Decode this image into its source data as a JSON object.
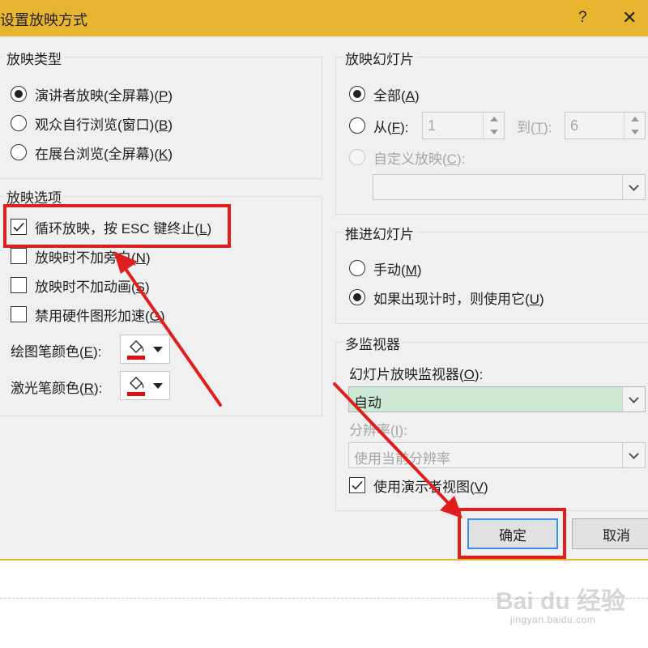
{
  "window": {
    "title": "设置放映方式",
    "help": "?",
    "close": "✕"
  },
  "show_type": {
    "legend": "放映类型",
    "options": [
      {
        "text": "演讲者放映(全屏幕)(",
        "key": "P",
        "tail": ")",
        "selected": true
      },
      {
        "text": "观众自行浏览(窗口)(",
        "key": "B",
        "tail": ")",
        "selected": false
      },
      {
        "text": "在展台浏览(全屏幕)(",
        "key": "K",
        "tail": ")",
        "selected": false
      }
    ]
  },
  "show_options": {
    "legend": "放映选项",
    "checks": [
      {
        "text": "循环放映，按 ESC 键终止(",
        "key": "L",
        "tail": ")",
        "checked": true
      },
      {
        "text": "放映时不加旁白(",
        "key": "N",
        "tail": ")",
        "checked": false
      },
      {
        "text": "放映时不加动画(",
        "key": "S",
        "tail": ")",
        "checked": false
      },
      {
        "text": "禁用硬件图形加速(",
        "key": "G",
        "tail": ")",
        "checked": false
      }
    ],
    "pen_color": {
      "text": "绘图笔颜色(",
      "key": "E",
      "tail": "):",
      "color": "#e01010"
    },
    "laser_color": {
      "text": "激光笔颜色(",
      "key": "R",
      "tail": "):",
      "color": "#e01010"
    }
  },
  "slides": {
    "legend": "放映幻灯片",
    "all": {
      "text": "全部(",
      "key": "A",
      "tail": ")",
      "selected": true
    },
    "from": {
      "text": "从(",
      "key": "F",
      "tail": "):",
      "selected": false,
      "value": "1"
    },
    "to": {
      "text": "到(",
      "key": "T",
      "tail": "):",
      "value": "6"
    },
    "custom": {
      "text": "自定义放映(",
      "key": "C",
      "tail": "):",
      "disabled": true,
      "value": ""
    }
  },
  "advance": {
    "legend": "推进幻灯片",
    "manual": {
      "text": "手动(",
      "key": "M",
      "tail": ")",
      "selected": false
    },
    "timings": {
      "text": "如果出现计时，则使用它(",
      "key": "U",
      "tail": ")",
      "selected": true
    }
  },
  "monitors": {
    "legend": "多监视器",
    "monitor_label": {
      "text": "幻灯片放映监视器(",
      "key": "O",
      "tail": "):"
    },
    "monitor_value": "自动",
    "monitor_bg": "#cde8d3",
    "resolution_label": {
      "text": "分辨率(",
      "key": "I",
      "tail": "):"
    },
    "resolution_value": "使用当前分辨率",
    "presenter_view": {
      "text": "使用演示者视图(",
      "key": "V",
      "tail": ")",
      "checked": true
    }
  },
  "buttons": {
    "ok": "确定",
    "cancel": "取消"
  },
  "watermark": {
    "brand": "Bai du 经验",
    "url": "jingyan.baidu.com"
  },
  "colors": {
    "title_bar": "#e8b530",
    "annotation_red": "#e01e1e",
    "focus_blue": "#3a8ee6"
  }
}
